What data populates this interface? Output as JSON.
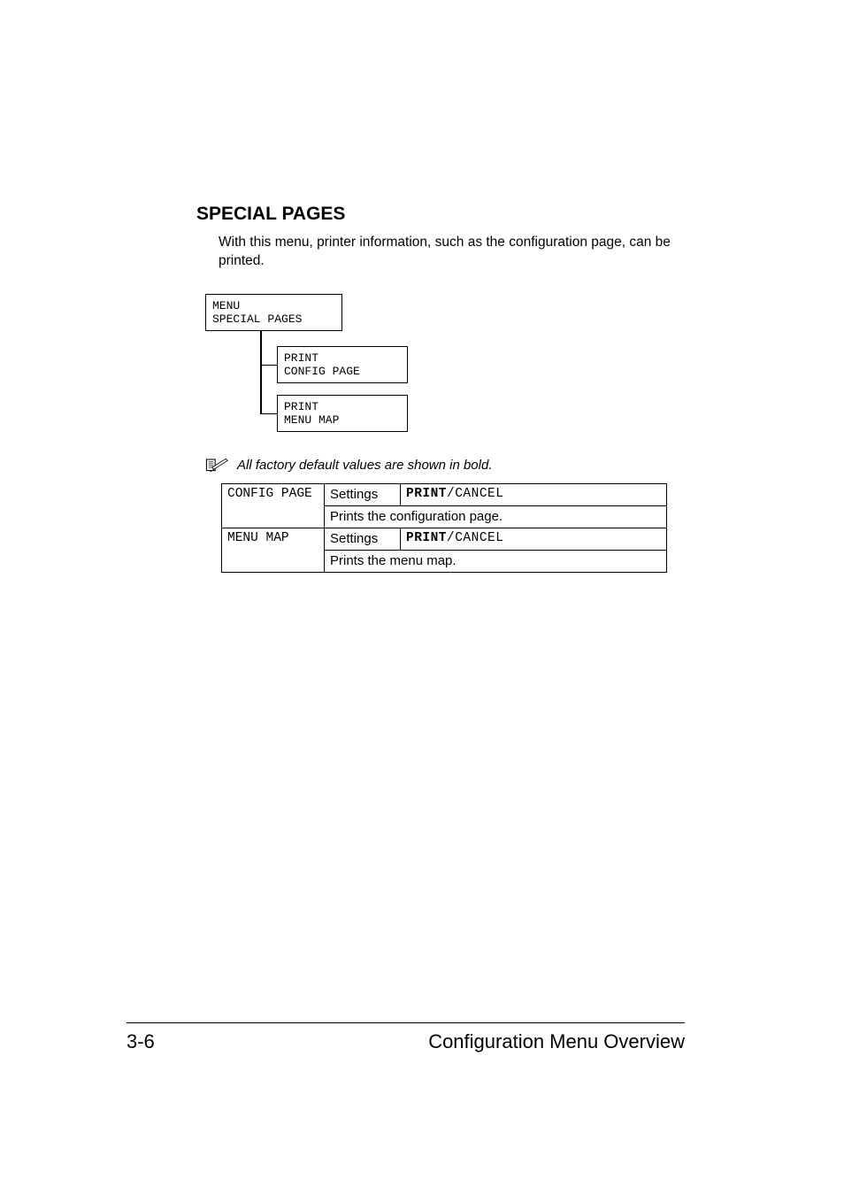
{
  "heading": "SPECIAL PAGES",
  "intro": "With this menu, printer information, such as the configuration page, can be printed.",
  "tree": {
    "root_line1": "MENU",
    "root_line2": "SPECIAL PAGES",
    "child1_line1": "PRINT",
    "child1_line2": "CONFIG PAGE",
    "child2_line1": "PRINT",
    "child2_line2": "MENU MAP"
  },
  "note": "All factory default values are shown in bold.",
  "table": {
    "rows": [
      {
        "name": "CONFIG PAGE",
        "settings_label": "Settings",
        "value_bold": "PRINT",
        "value_sep": "/",
        "value_plain": "CANCEL",
        "desc": "Prints the configuration page."
      },
      {
        "name": "MENU MAP",
        "settings_label": "Settings",
        "value_bold": "PRINT",
        "value_sep": "/",
        "value_plain": "CANCEL",
        "desc": "Prints the menu map."
      }
    ]
  },
  "footer": {
    "page_number": "3-6",
    "section_title": "Configuration Menu Overview"
  }
}
